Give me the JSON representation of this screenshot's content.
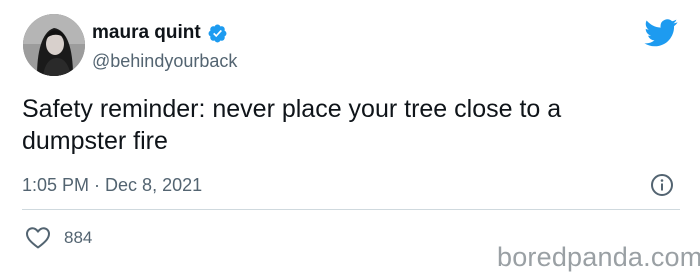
{
  "tweet": {
    "author": {
      "display_name": "maura quint",
      "handle": "@behindyourback",
      "verified": true,
      "avatar_icon": "profile-photo"
    },
    "text": "Safety reminder: never place your tree close to a dumpster fire",
    "time": "1:05 PM",
    "separator": " · ",
    "date": "Dec 8, 2021",
    "likes": "884",
    "icons": {
      "brand": "twitter-bird-icon",
      "verified": "verified-badge-icon",
      "info": "info-icon",
      "like": "heart-icon"
    }
  },
  "watermark": "boredpanda.com",
  "colors": {
    "text": "#0f1419",
    "secondary": "#536471",
    "twitter_blue": "#1d9bf0",
    "divider": "#cfd9de",
    "watermark": "#9aa0a4"
  }
}
